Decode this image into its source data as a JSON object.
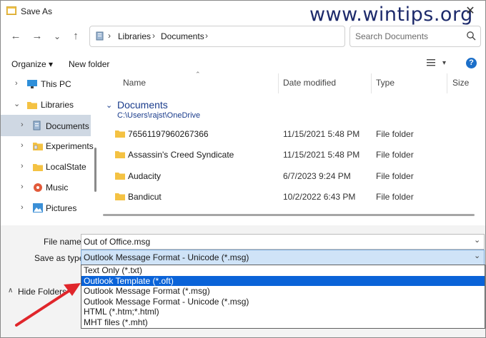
{
  "window": {
    "title": "Save As",
    "watermark": "www.wintips.org",
    "close_glyph": "✕"
  },
  "nav": {
    "back": "←",
    "forward": "→",
    "dropdown": "⌄",
    "up": "↑",
    "breadcrumb": [
      "Libraries",
      "Documents"
    ],
    "separator": "›",
    "search_placeholder": "Search Documents"
  },
  "toolbar": {
    "organize": "Organize ▾",
    "new_folder": "New folder",
    "view_caret": "▾",
    "help": "?"
  },
  "tree": [
    {
      "label": "This PC",
      "icon": "monitor-icon",
      "chev": "›"
    },
    {
      "label": "Libraries",
      "icon": "folder-icon",
      "chev": "⌄"
    },
    {
      "label": "Documents",
      "icon": "documents-icon",
      "chev": "›",
      "selected": true
    },
    {
      "label": "Experiments",
      "icon": "folder-lock-icon",
      "chev": "›"
    },
    {
      "label": "LocalState",
      "icon": "folder-icon",
      "chev": "›"
    },
    {
      "label": "Music",
      "icon": "music-icon",
      "chev": "›"
    },
    {
      "label": "Pictures",
      "icon": "pictures-icon",
      "chev": "›"
    }
  ],
  "columns": {
    "name": "Name",
    "date": "Date modified",
    "type": "Type",
    "size": "Size"
  },
  "group": {
    "title": "Documents",
    "path": "C:\\Users\\rajst\\OneDrive",
    "chev": "⌄"
  },
  "files": [
    {
      "name": "76561197960267366",
      "date": "11/15/2021 5:48 PM",
      "type": "File folder"
    },
    {
      "name": "Assassin's Creed Syndicate",
      "date": "11/15/2021 5:48 PM",
      "type": "File folder"
    },
    {
      "name": "Audacity",
      "date": "6/7/2023 9:24 PM",
      "type": "File folder"
    },
    {
      "name": "Bandicut",
      "date": "10/2/2022 6:43 PM",
      "type": "File folder"
    }
  ],
  "form": {
    "filename_label": "File name:",
    "filename_value": "Out of Office.msg",
    "type_label": "Save as type:",
    "type_value": "Outlook Message Format - Unicode (*.msg)",
    "type_options": [
      "Text Only (*.txt)",
      "Outlook Template (*.oft)",
      "Outlook Message Format (*.msg)",
      "Outlook Message Format - Unicode (*.msg)",
      "HTML (*.htm;*.html)",
      "MHT files (*.mht)"
    ],
    "highlighted_index": 1
  },
  "footer": {
    "hide_folders": "Hide Folders",
    "chev": "∧"
  },
  "colors": {
    "accent": "#0a63d8",
    "annotation_arrow": "#e0262b"
  }
}
